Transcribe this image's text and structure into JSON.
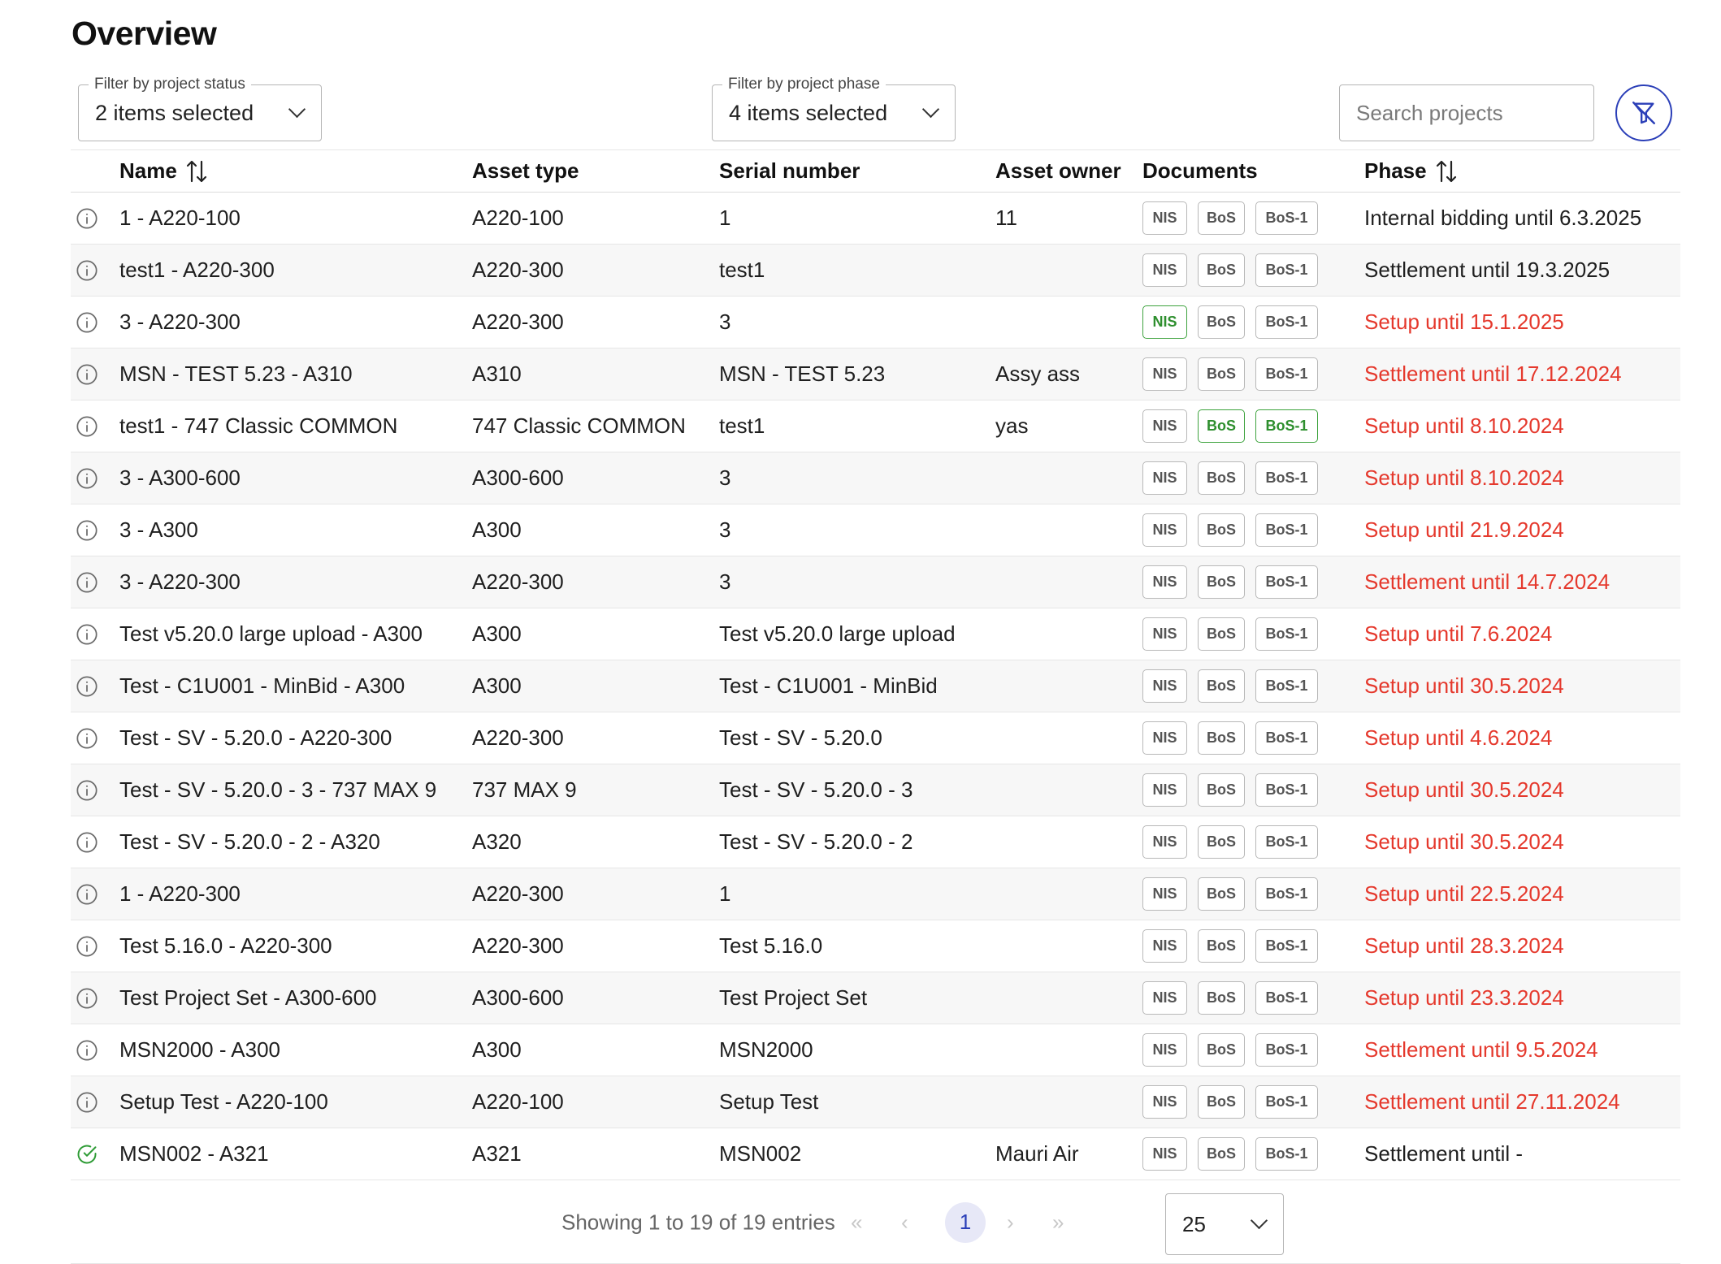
{
  "title": "Overview",
  "filters": {
    "status": {
      "legend": "Filter by project status",
      "value": "2 items selected"
    },
    "phase": {
      "legend": "Filter by project phase",
      "value": "4 items selected"
    }
  },
  "search": {
    "placeholder": "Search projects"
  },
  "table": {
    "headers": {
      "name": "Name",
      "asset_type": "Asset type",
      "serial_number": "Serial number",
      "asset_owner": "Asset owner",
      "documents": "Documents",
      "phase": "Phase"
    },
    "rows": [
      {
        "icon": "info-icon",
        "name": "1 - A220-100",
        "asset_type": "A220-100",
        "serial": "1",
        "owner": "11",
        "docs": [
          "NIS",
          "BoS",
          "BoS-1"
        ],
        "docs_green": [
          false,
          false,
          false
        ],
        "phase": "Internal bidding until 6.3.2025",
        "phase_overdue": false
      },
      {
        "icon": "info-icon",
        "name": "test1 - A220-300",
        "asset_type": "A220-300",
        "serial": "test1",
        "owner": "",
        "docs": [
          "NIS",
          "BoS",
          "BoS-1"
        ],
        "docs_green": [
          false,
          false,
          false
        ],
        "phase": "Settlement until 19.3.2025",
        "phase_overdue": false
      },
      {
        "icon": "info-icon",
        "name": "3 - A220-300",
        "asset_type": "A220-300",
        "serial": "3",
        "owner": "",
        "docs": [
          "NIS",
          "BoS",
          "BoS-1"
        ],
        "docs_green": [
          true,
          false,
          false
        ],
        "phase": "Setup until 15.1.2025",
        "phase_overdue": true
      },
      {
        "icon": "info-icon",
        "name": "MSN - TEST 5.23 - A310",
        "asset_type": "A310",
        "serial": "MSN - TEST 5.23",
        "owner": "Assy ass",
        "docs": [
          "NIS",
          "BoS",
          "BoS-1"
        ],
        "docs_green": [
          false,
          false,
          false
        ],
        "phase": "Settlement until 17.12.2024",
        "phase_overdue": true
      },
      {
        "icon": "info-icon",
        "name": "test1 - 747 Classic COMMON",
        "asset_type": "747 Classic COMMON",
        "serial": "test1",
        "owner": "yas",
        "docs": [
          "NIS",
          "BoS",
          "BoS-1"
        ],
        "docs_green": [
          false,
          true,
          true
        ],
        "phase": "Setup until 8.10.2024",
        "phase_overdue": true
      },
      {
        "icon": "info-icon",
        "name": "3 - A300-600",
        "asset_type": "A300-600",
        "serial": "3",
        "owner": "",
        "docs": [
          "NIS",
          "BoS",
          "BoS-1"
        ],
        "docs_green": [
          false,
          false,
          false
        ],
        "phase": "Setup until 8.10.2024",
        "phase_overdue": true
      },
      {
        "icon": "info-icon",
        "name": "3 - A300",
        "asset_type": "A300",
        "serial": "3",
        "owner": "",
        "docs": [
          "NIS",
          "BoS",
          "BoS-1"
        ],
        "docs_green": [
          false,
          false,
          false
        ],
        "phase": "Setup until 21.9.2024",
        "phase_overdue": true
      },
      {
        "icon": "info-icon",
        "name": "3 - A220-300",
        "asset_type": "A220-300",
        "serial": "3",
        "owner": "",
        "docs": [
          "NIS",
          "BoS",
          "BoS-1"
        ],
        "docs_green": [
          false,
          false,
          false
        ],
        "phase": "Settlement until 14.7.2024",
        "phase_overdue": true
      },
      {
        "icon": "info-icon",
        "name": "Test v5.20.0 large upload - A300",
        "asset_type": "A300",
        "serial": "Test v5.20.0 large upload",
        "owner": "",
        "docs": [
          "NIS",
          "BoS",
          "BoS-1"
        ],
        "docs_green": [
          false,
          false,
          false
        ],
        "phase": "Setup until 7.6.2024",
        "phase_overdue": true
      },
      {
        "icon": "info-icon",
        "name": "Test - C1U001 - MinBid - A300",
        "asset_type": "A300",
        "serial": "Test - C1U001 - MinBid",
        "owner": "",
        "docs": [
          "NIS",
          "BoS",
          "BoS-1"
        ],
        "docs_green": [
          false,
          false,
          false
        ],
        "phase": "Setup until 30.5.2024",
        "phase_overdue": true
      },
      {
        "icon": "info-icon",
        "name": "Test - SV - 5.20.0 - A220-300",
        "asset_type": "A220-300",
        "serial": "Test - SV - 5.20.0",
        "owner": "",
        "docs": [
          "NIS",
          "BoS",
          "BoS-1"
        ],
        "docs_green": [
          false,
          false,
          false
        ],
        "phase": "Setup until 4.6.2024",
        "phase_overdue": true
      },
      {
        "icon": "info-icon",
        "name": "Test - SV - 5.20.0 - 3 - 737 MAX 9",
        "asset_type": "737 MAX 9",
        "serial": "Test - SV - 5.20.0 - 3",
        "owner": "",
        "docs": [
          "NIS",
          "BoS",
          "BoS-1"
        ],
        "docs_green": [
          false,
          false,
          false
        ],
        "phase": "Setup until 30.5.2024",
        "phase_overdue": true
      },
      {
        "icon": "info-icon",
        "name": "Test - SV - 5.20.0 - 2 - A320",
        "asset_type": "A320",
        "serial": "Test - SV - 5.20.0 - 2",
        "owner": "",
        "docs": [
          "NIS",
          "BoS",
          "BoS-1"
        ],
        "docs_green": [
          false,
          false,
          false
        ],
        "phase": "Setup until 30.5.2024",
        "phase_overdue": true
      },
      {
        "icon": "info-icon",
        "name": "1 - A220-300",
        "asset_type": "A220-300",
        "serial": "1",
        "owner": "",
        "docs": [
          "NIS",
          "BoS",
          "BoS-1"
        ],
        "docs_green": [
          false,
          false,
          false
        ],
        "phase": "Setup until 22.5.2024",
        "phase_overdue": true
      },
      {
        "icon": "info-icon",
        "name": "Test 5.16.0 - A220-300",
        "asset_type": "A220-300",
        "serial": "Test 5.16.0",
        "owner": "",
        "docs": [
          "NIS",
          "BoS",
          "BoS-1"
        ],
        "docs_green": [
          false,
          false,
          false
        ],
        "phase": "Setup until 28.3.2024",
        "phase_overdue": true
      },
      {
        "icon": "info-icon",
        "name": "Test Project Set - A300-600",
        "asset_type": "A300-600",
        "serial": "Test Project Set",
        "owner": "",
        "docs": [
          "NIS",
          "BoS",
          "BoS-1"
        ],
        "docs_green": [
          false,
          false,
          false
        ],
        "phase": "Setup until 23.3.2024",
        "phase_overdue": true
      },
      {
        "icon": "info-icon",
        "name": "MSN2000 - A300",
        "asset_type": "A300",
        "serial": "MSN2000",
        "owner": "",
        "docs": [
          "NIS",
          "BoS",
          "BoS-1"
        ],
        "docs_green": [
          false,
          false,
          false
        ],
        "phase": "Settlement until 9.5.2024",
        "phase_overdue": true
      },
      {
        "icon": "info-icon",
        "name": "Setup Test - A220-100",
        "asset_type": "A220-100",
        "serial": "Setup Test",
        "owner": "",
        "docs": [
          "NIS",
          "BoS",
          "BoS-1"
        ],
        "docs_green": [
          false,
          false,
          false
        ],
        "phase": "Settlement until 27.11.2024",
        "phase_overdue": true
      },
      {
        "icon": "check-circle-icon",
        "name": "MSN002 - A321",
        "asset_type": "A321",
        "serial": "MSN002",
        "owner": "Mauri Air",
        "docs": [
          "NIS",
          "BoS",
          "BoS-1"
        ],
        "docs_green": [
          false,
          false,
          false
        ],
        "phase": "Settlement until -",
        "phase_overdue": false
      }
    ]
  },
  "pagination": {
    "showing": "Showing 1 to 19 of 19 entries",
    "first": "«",
    "prev": "‹",
    "current_page": "1",
    "next": "›",
    "last": "»",
    "page_size": "25"
  },
  "colors": {
    "accent": "#2b3fb8",
    "overdue_red": "#e5392d",
    "doc_green": "#2e8f2e"
  }
}
